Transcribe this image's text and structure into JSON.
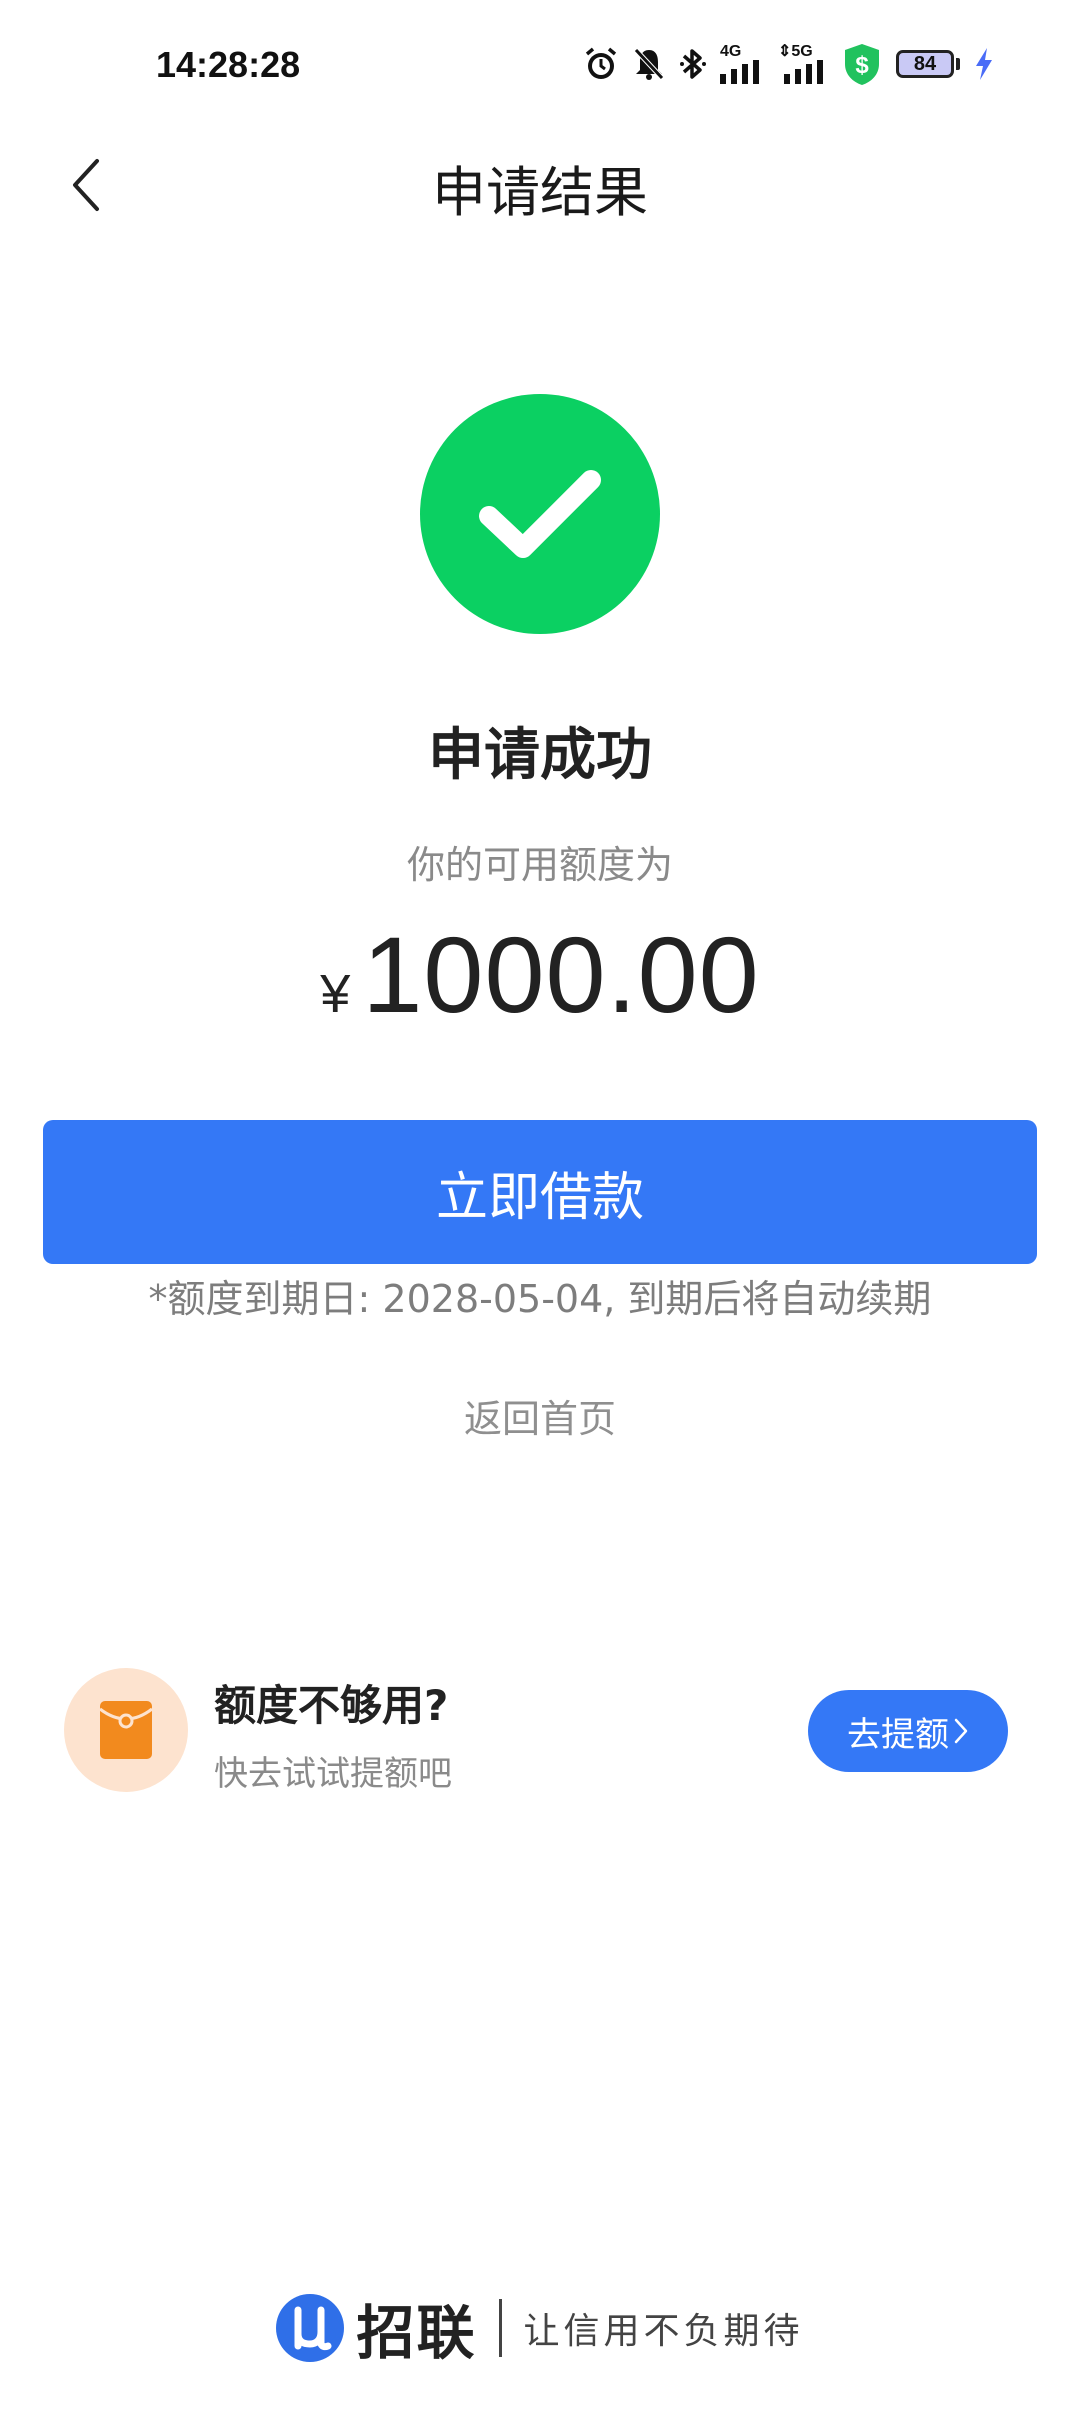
{
  "status_bar": {
    "time": "14:28:28",
    "network_1": "4G",
    "network_2": "5G",
    "battery": "84"
  },
  "nav": {
    "title": "申请结果"
  },
  "result": {
    "title": "申请成功",
    "limit_label": "你的可用额度为",
    "currency": "¥",
    "amount": "1000.00"
  },
  "actions": {
    "borrow_label": "立即借款",
    "expiry_note": "*额度到期日: 2028-05-04, 到期后将自动续期",
    "home_label": "返回首页"
  },
  "promo": {
    "title": "额度不够用?",
    "subtitle": "快去试试提额吧",
    "button_label": "去提额"
  },
  "brand": {
    "name": "招联",
    "slogan": "让信用不负期待"
  },
  "colors": {
    "primary": "#3478f6",
    "success": "#0bd062",
    "promo_icon": "#f28a1e",
    "promo_bg": "#fde3cf"
  }
}
